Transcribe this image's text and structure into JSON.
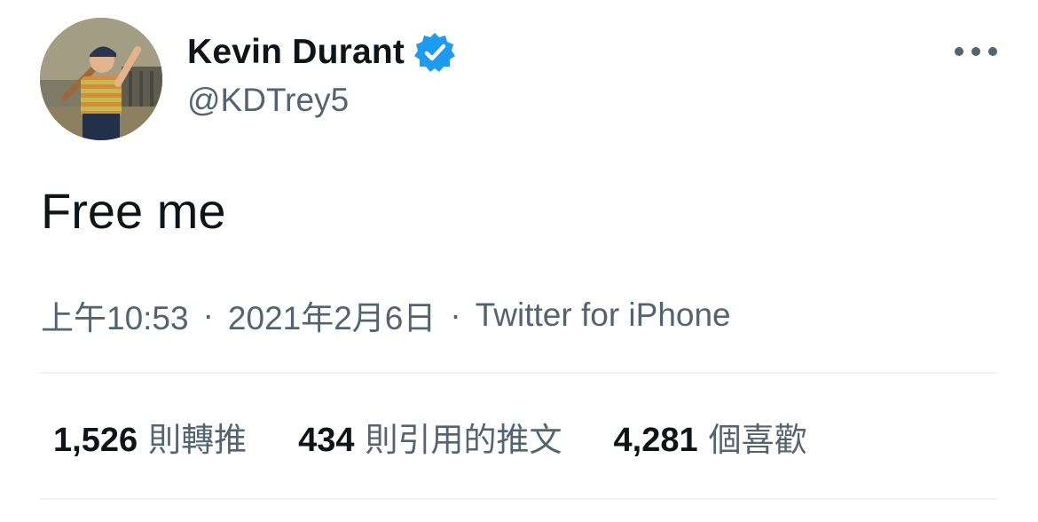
{
  "author": {
    "display_name": "Kevin Durant",
    "handle": "@KDTrey5",
    "verified": true,
    "avatar": "profile-photo",
    "verified_icon": "verified-badge-icon"
  },
  "tweet": {
    "text": "Free me",
    "time": "上午10:53",
    "date": "2021年2月6日",
    "separator": "·",
    "source": "Twitter for iPhone"
  },
  "stats": {
    "retweets": {
      "count": "1,526",
      "label": "則轉推"
    },
    "quotes": {
      "count": "434",
      "label": "則引用的推文"
    },
    "likes": {
      "count": "4,281",
      "label": "個喜歡"
    }
  },
  "icons": {
    "more": "more-options-icon"
  },
  "colors": {
    "verified": "#1d9bf0",
    "primary_text": "#0f1419",
    "secondary_text": "#536471",
    "divider": "#eff3f4"
  }
}
